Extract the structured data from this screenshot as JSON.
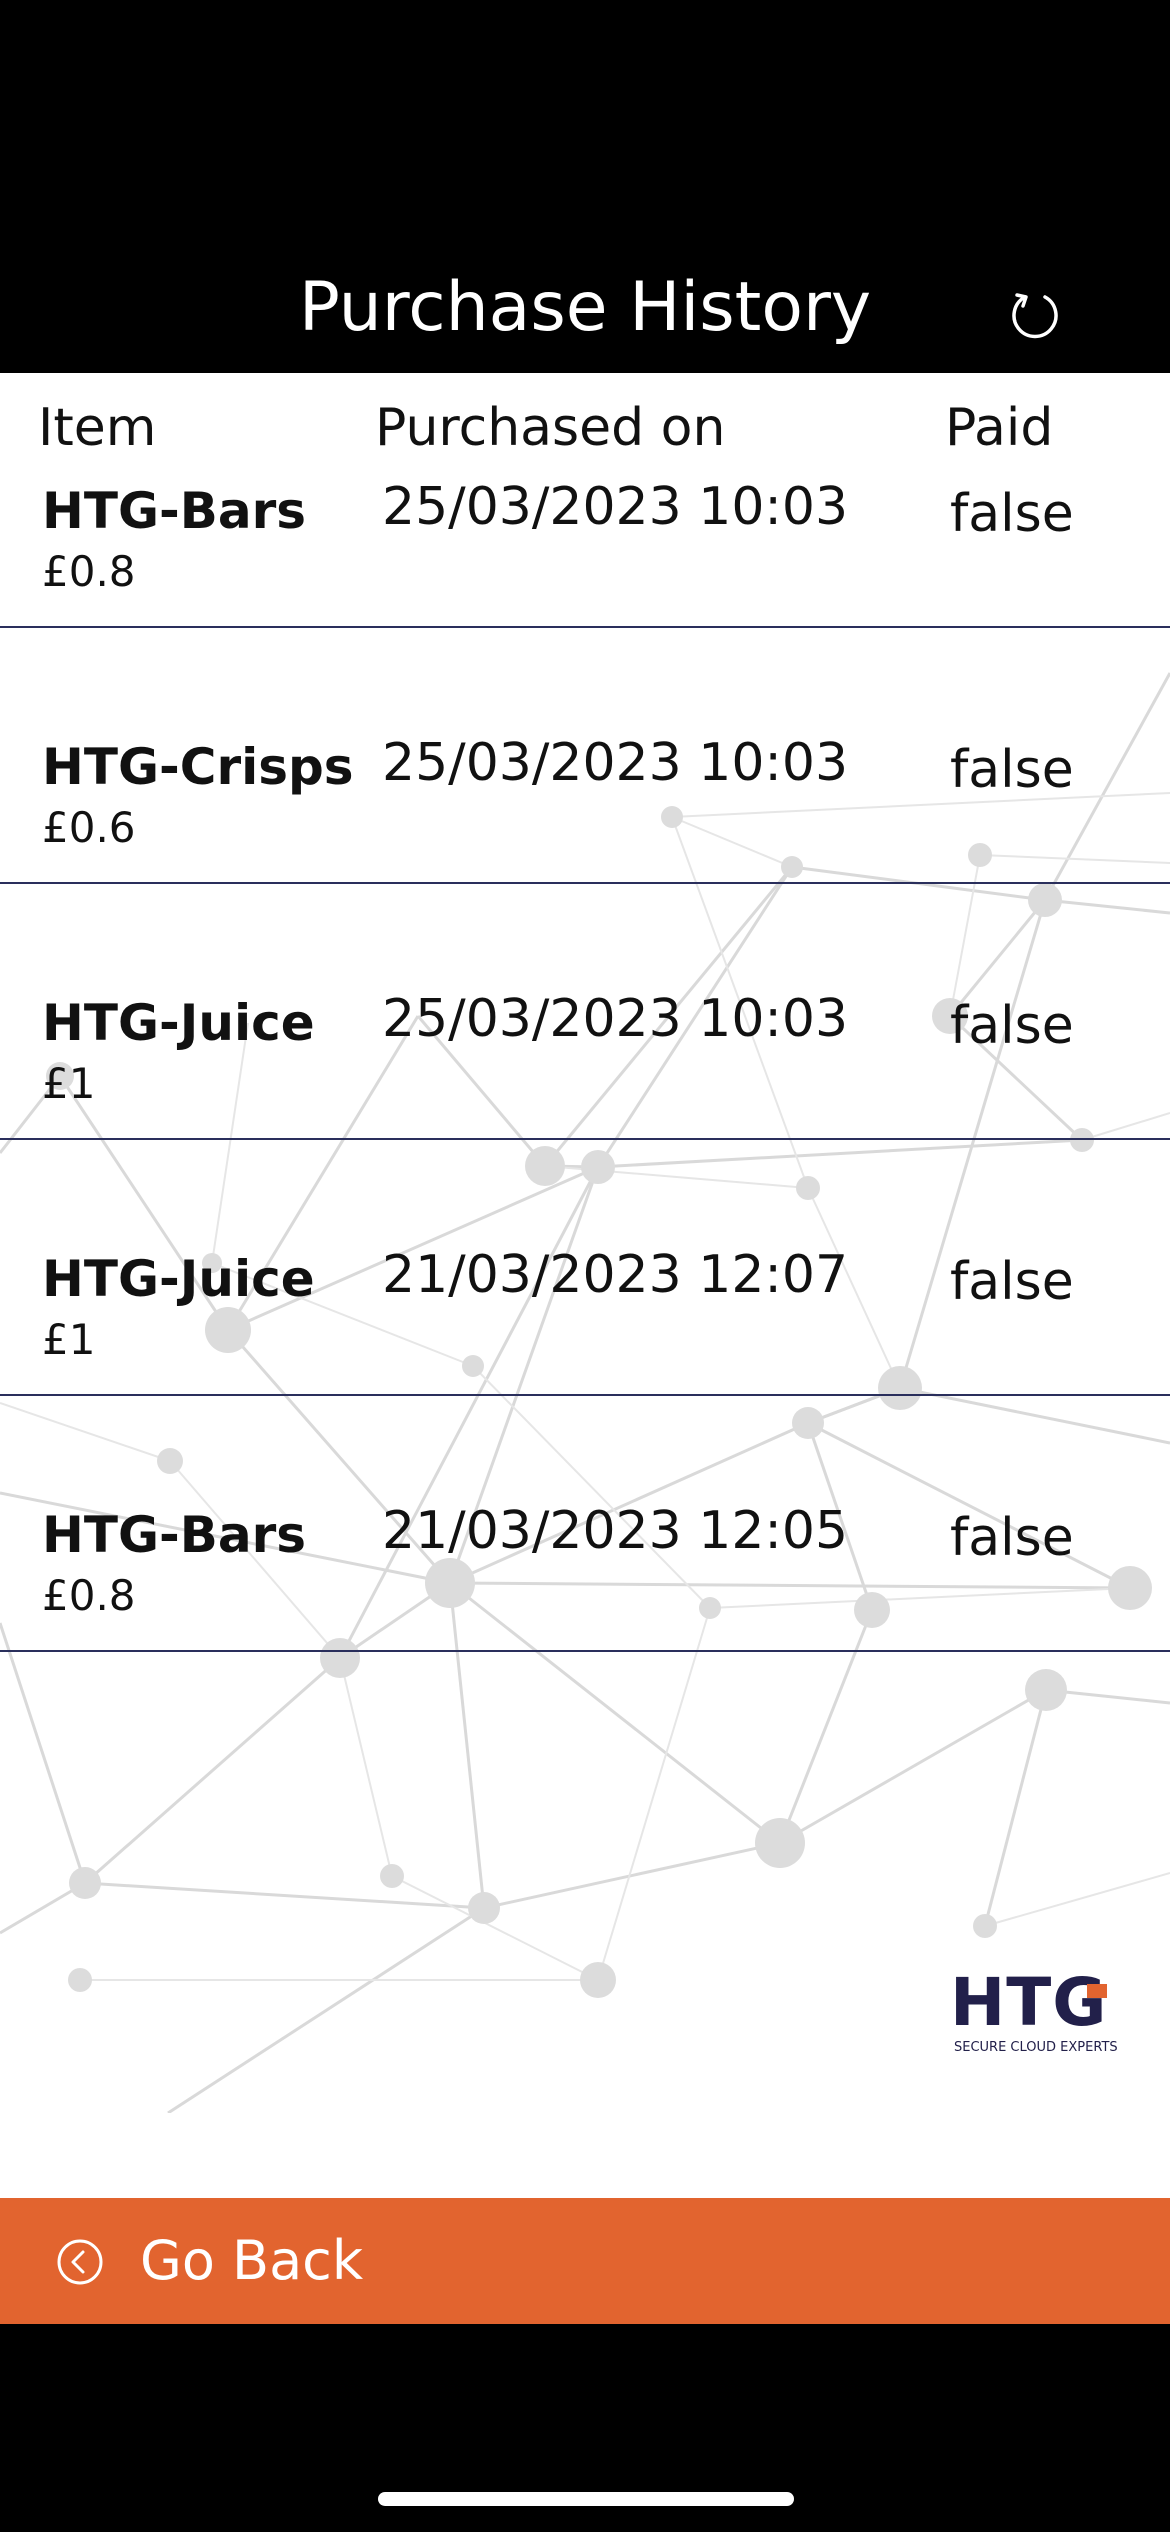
{
  "header": {
    "title": "Purchase History",
    "refresh_icon": "refresh-icon"
  },
  "columns": {
    "item": "Item",
    "purchased_on": "Purchased on",
    "paid": "Paid"
  },
  "purchases": [
    {
      "name": "HTG-Bars",
      "price": "£0.8",
      "date": "25/03/2023 10:03",
      "paid": "false"
    },
    {
      "name": "HTG-Crisps",
      "price": "£0.6",
      "date": "25/03/2023 10:03",
      "paid": "false"
    },
    {
      "name": "HTG-Juice",
      "price": "£1",
      "date": "25/03/2023 10:03",
      "paid": "false"
    },
    {
      "name": "HTG-Juice",
      "price": "£1",
      "date": "21/03/2023 12:07",
      "paid": "false"
    },
    {
      "name": "HTG-Bars",
      "price": "£0.8",
      "date": "21/03/2023 12:05",
      "paid": "false"
    }
  ],
  "logo": {
    "text": "HTG",
    "tagline": "SECURE CLOUD EXPERTS"
  },
  "footer": {
    "go_back_label": "Go Back",
    "go_back_icon": "chevron-left-circle-icon"
  },
  "colors": {
    "header_bg": "#000000",
    "accent": "#e2642f",
    "divider": "#2a2f5c",
    "logo": "#22204a"
  }
}
